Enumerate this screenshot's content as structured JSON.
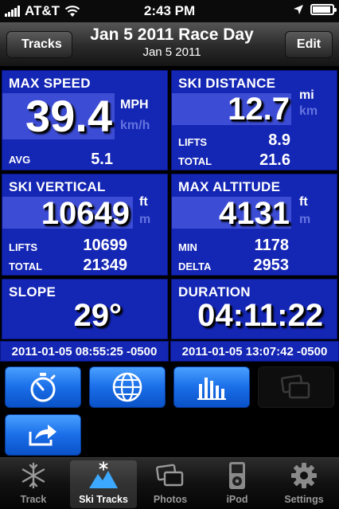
{
  "status_bar": {
    "carrier": "AT&T",
    "time": "2:43 PM"
  },
  "nav": {
    "back_label": "Tracks",
    "title": "Jan 5 2011 Race Day",
    "subtitle": "Jan 5 2011",
    "edit_label": "Edit"
  },
  "panels": {
    "max_speed": {
      "label": "MAX SPEED",
      "value": "39.4",
      "unit_active": "MPH",
      "unit_inactive": "km/h",
      "avg_label": "AVG",
      "avg_value": "5.1"
    },
    "ski_distance": {
      "label": "SKI DISTANCE",
      "value": "12.7",
      "unit_active": "mi",
      "unit_inactive": "km",
      "lifts_label": "LIFTS",
      "lifts_value": "8.9",
      "total_label": "TOTAL",
      "total_value": "21.6"
    },
    "ski_vertical": {
      "label": "SKI VERTICAL",
      "value": "10649",
      "unit_active": "ft",
      "unit_inactive": "m",
      "lifts_label": "LIFTS",
      "lifts_value": "10699",
      "total_label": "TOTAL",
      "total_value": "21349"
    },
    "max_altitude": {
      "label": "MAX ALTITUDE",
      "value": "4131",
      "unit_active": "ft",
      "unit_inactive": "m",
      "min_label": "MIN",
      "min_value": "1178",
      "delta_label": "DELTA",
      "delta_value": "2953"
    },
    "slope": {
      "label": "SLOPE",
      "value": "29°"
    },
    "duration": {
      "label": "DURATION",
      "value": "04:11:22"
    }
  },
  "dates": {
    "start": "2011-01-05 08:55:25 -0500",
    "end": "2011-01-05 13:07:42 -0500"
  },
  "actions": [
    {
      "icon": "stopwatch-icon",
      "enabled": true
    },
    {
      "icon": "globe-icon",
      "enabled": true
    },
    {
      "icon": "bar-chart-icon",
      "enabled": true
    },
    {
      "icon": "photos-icon",
      "enabled": false
    },
    {
      "icon": "share-icon",
      "enabled": true
    }
  ],
  "tabs": [
    {
      "label": "Track",
      "icon": "snowflake-icon",
      "active": false
    },
    {
      "label": "Ski Tracks",
      "icon": "ski-tracks-icon",
      "active": true
    },
    {
      "label": "Photos",
      "icon": "photos-icon",
      "active": false
    },
    {
      "label": "iPod",
      "icon": "ipod-icon",
      "active": false
    },
    {
      "label": "Settings",
      "icon": "gear-icon",
      "active": false
    }
  ],
  "colors": {
    "panel_blue": "#1426b4",
    "highlight_blue": "#3c4cd4",
    "button_blue": "#1a6ee8"
  }
}
